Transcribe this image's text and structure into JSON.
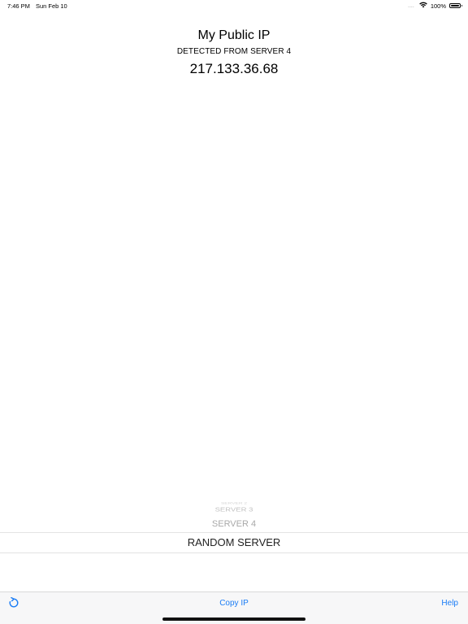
{
  "status_bar": {
    "time": "7:46 PM",
    "date": "Sun Feb 10",
    "signal": "....",
    "battery_percent": "100%",
    "battery_level": 1.0
  },
  "header": {
    "title": "My Public IP",
    "detected_label": "DETECTED FROM SERVER 4",
    "ip": "217.133.36.68"
  },
  "picker": {
    "items": [
      {
        "label": "SERVER 2",
        "state": "far"
      },
      {
        "label": "SERVER 3",
        "state": "near"
      },
      {
        "label": "SERVER 4",
        "state": "near"
      },
      {
        "label": "RANDOM SERVER",
        "state": "selected"
      }
    ]
  },
  "toolbar": {
    "copy_label": "Copy IP",
    "help_label": "Help",
    "accent_color": "#1a7cf5",
    "refresh_icon": "refresh-icon"
  }
}
